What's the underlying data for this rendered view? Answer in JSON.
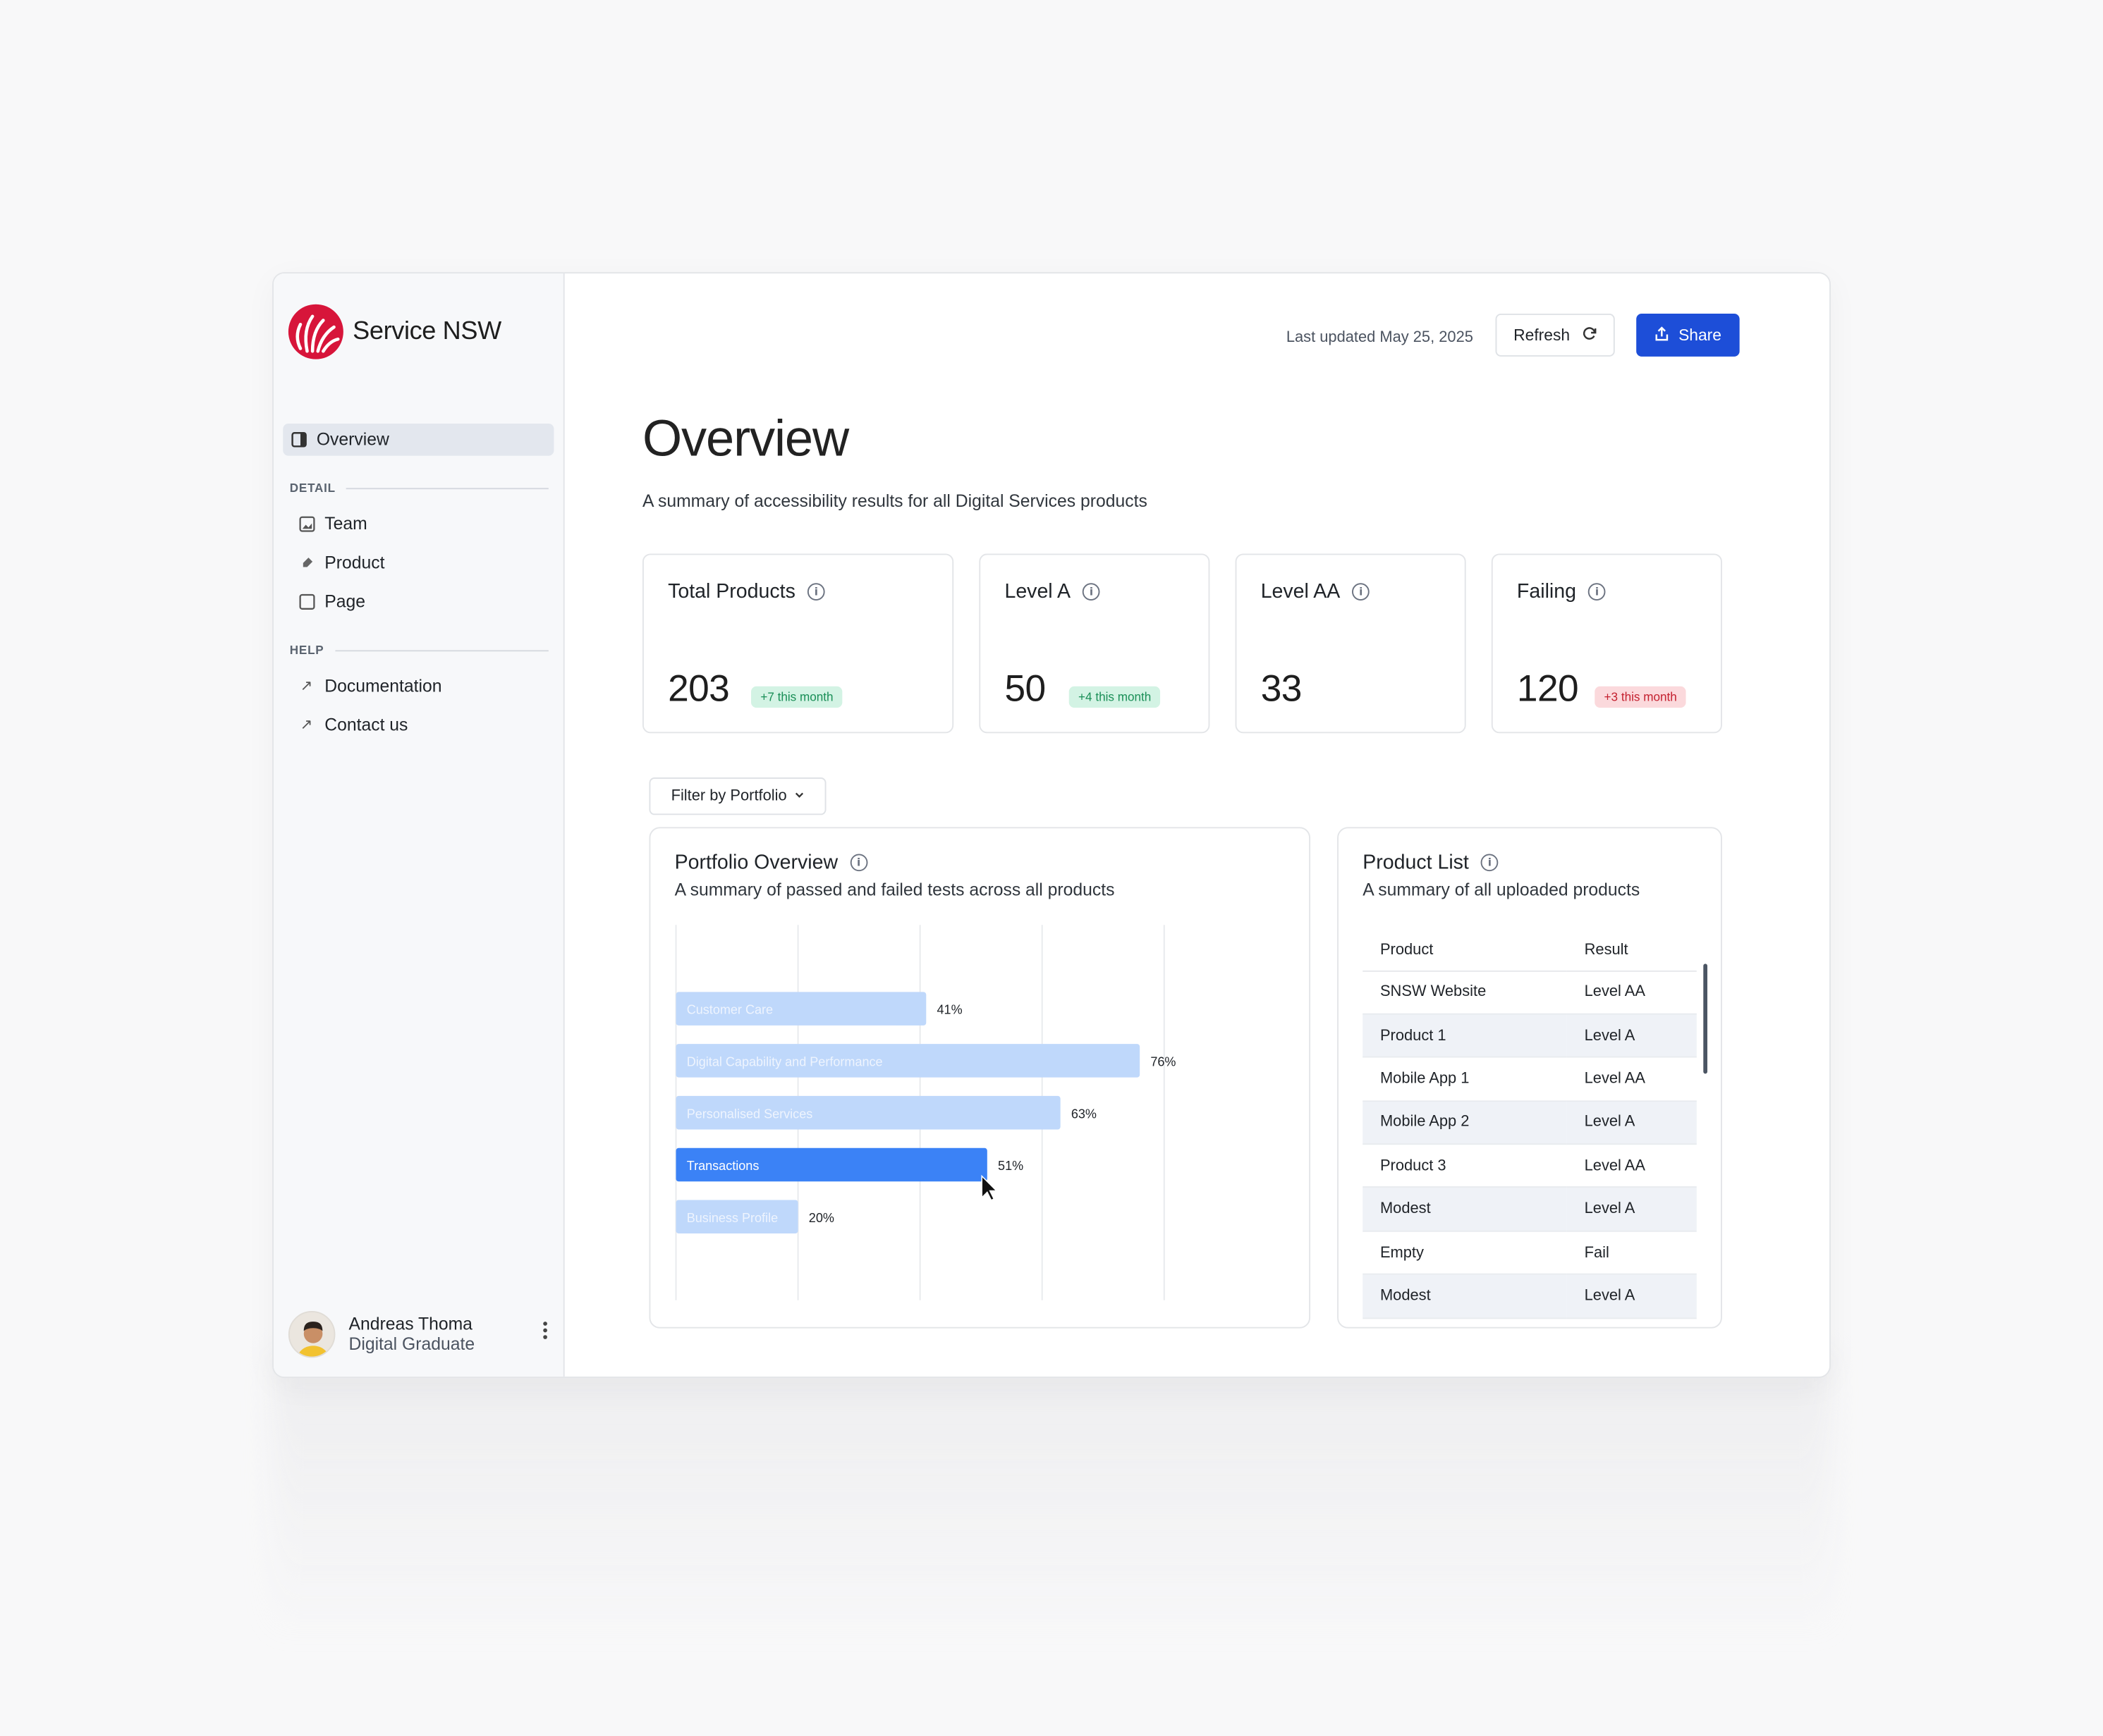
{
  "brand": {
    "name": "Service NSW",
    "color": "#d7153a"
  },
  "nav": {
    "overview": {
      "label": "Overview",
      "icon": "book-icon"
    },
    "detail_heading": "DETAIL",
    "detail_items": [
      {
        "label": "Team",
        "icon": "image-icon"
      },
      {
        "label": "Product",
        "icon": "tag-icon"
      },
      {
        "label": "Page",
        "icon": "square-icon"
      }
    ],
    "help_heading": "HELP",
    "help_items": [
      {
        "label": "Documentation",
        "icon": "arrow-up-right-icon"
      },
      {
        "label": "Contact us",
        "icon": "arrow-up-right-icon"
      }
    ]
  },
  "user": {
    "name": "Andreas Thoma",
    "role": "Digital Graduate"
  },
  "toolbar": {
    "last_updated": "Last updated May 25, 2025",
    "refresh_label": "Refresh",
    "share_label": "Share",
    "share_color": "#1d4ed8"
  },
  "page": {
    "title": "Overview",
    "subtitle": "A summary of accessibility results for all Digital Services products"
  },
  "stats": [
    {
      "label": "Total Products",
      "value": "203",
      "badge": "+7 this month",
      "badge_tone": "positive"
    },
    {
      "label": "Level A",
      "value": "50",
      "badge": "+4 this month",
      "badge_tone": "positive"
    },
    {
      "label": "Level AA",
      "value": "33",
      "badge": ""
    },
    {
      "label": "Failing",
      "value": "120",
      "badge": "+3 this month",
      "badge_tone": "negative"
    }
  ],
  "filter": {
    "label": "Filter by Portfolio"
  },
  "portfolio": {
    "title": "Portfolio Overview",
    "subtitle": "A summary of passed and failed tests across all products"
  },
  "chart_data": {
    "type": "bar",
    "orientation": "horizontal",
    "categories": [
      "Customer Care",
      "Digital Capability and Performance",
      "Personalised Services",
      "Transactions",
      "Business Profile"
    ],
    "values": [
      41,
      76,
      63,
      51,
      20
    ],
    "value_labels": [
      "41%",
      "76%",
      "63%",
      "51%",
      "20%"
    ],
    "highlighted": "Transactions",
    "xlim": [
      0,
      100
    ],
    "grid": true,
    "colors": {
      "bar": "#bfd8fb",
      "highlight": "#3b82f6"
    }
  },
  "product_list": {
    "title": "Product List",
    "subtitle": "A summary of all uploaded products",
    "columns": [
      "Product",
      "Result"
    ],
    "rows": [
      {
        "product": "SNSW Website",
        "result": "Level AA",
        "status": "pass"
      },
      {
        "product": "Product 1",
        "result": "Level A",
        "status": "pass"
      },
      {
        "product": "Mobile App 1",
        "result": "Level AA",
        "status": "pass"
      },
      {
        "product": "Mobile App 2",
        "result": "Level A",
        "status": "pass"
      },
      {
        "product": "Product 3",
        "result": "Level AA",
        "status": "pass"
      },
      {
        "product": "Modest",
        "result": "Level A",
        "status": "pass"
      },
      {
        "product": "Empty",
        "result": "Fail",
        "status": "fail"
      },
      {
        "product": "Modest",
        "result": "Level A",
        "status": "pass"
      }
    ]
  }
}
